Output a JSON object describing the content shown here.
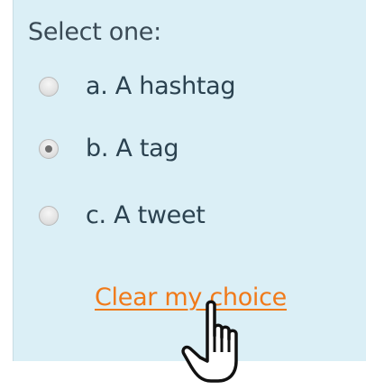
{
  "question": {
    "prompt": "Select one:",
    "options": [
      {
        "label": "a. A hashtag",
        "selected": false
      },
      {
        "label": "b. A tag",
        "selected": true
      },
      {
        "label": "c. A tweet",
        "selected": false
      }
    ],
    "clear_label": "Clear my choice"
  },
  "colors": {
    "panel_background": "#dbeff6",
    "link": "#f07a1a",
    "text": "#2b4250"
  },
  "cursor": {
    "icon": "hand-pointer-icon"
  }
}
